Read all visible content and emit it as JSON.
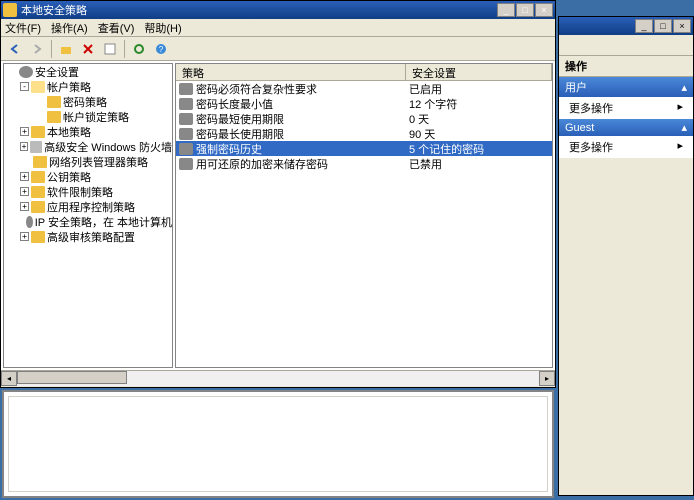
{
  "main_window": {
    "title": "本地安全策略",
    "menus": [
      "文件(F)",
      "操作(A)",
      "查看(V)",
      "帮助(H)"
    ]
  },
  "tree": {
    "root": "安全设置",
    "items": [
      {
        "label": "帐户策略",
        "exp": "-",
        "depth": 1,
        "icon": "i-folder-open"
      },
      {
        "label": "密码策略",
        "exp": "",
        "depth": 2,
        "icon": "i-folder"
      },
      {
        "label": "帐户锁定策略",
        "exp": "",
        "depth": 2,
        "icon": "i-folder"
      },
      {
        "label": "本地策略",
        "exp": "+",
        "depth": 1,
        "icon": "i-folder"
      },
      {
        "label": "高级安全 Windows 防火墙",
        "exp": "+",
        "depth": 1,
        "icon": "i-shield"
      },
      {
        "label": "网络列表管理器策略",
        "exp": "",
        "depth": 1,
        "icon": "i-folder"
      },
      {
        "label": "公钥策略",
        "exp": "+",
        "depth": 1,
        "icon": "i-folder"
      },
      {
        "label": "软件限制策略",
        "exp": "+",
        "depth": 1,
        "icon": "i-folder"
      },
      {
        "label": "应用程序控制策略",
        "exp": "+",
        "depth": 1,
        "icon": "i-folder"
      },
      {
        "label": "IP 安全策略，在 本地计算机",
        "exp": "",
        "depth": 1,
        "icon": "i-gear"
      },
      {
        "label": "高级审核策略配置",
        "exp": "+",
        "depth": 1,
        "icon": "i-folder"
      }
    ]
  },
  "list": {
    "col_a": "策略",
    "col_b": "安全设置",
    "rows": [
      {
        "name": "密码必须符合复杂性要求",
        "value": "已启用",
        "sel": false
      },
      {
        "name": "密码长度最小值",
        "value": "12 个字符",
        "sel": false
      },
      {
        "name": "密码最短使用期限",
        "value": "0 天",
        "sel": false
      },
      {
        "name": "密码最长使用期限",
        "value": "90 天",
        "sel": false
      },
      {
        "name": "强制密码历史",
        "value": "5 个记住的密码",
        "sel": true
      },
      {
        "name": "用可还原的加密来储存密码",
        "value": "已禁用",
        "sel": false
      }
    ]
  },
  "actions": {
    "header": "操作",
    "g1": "用户",
    "g1_item": "更多操作",
    "g2": "Guest",
    "g2_item": "更多操作"
  }
}
